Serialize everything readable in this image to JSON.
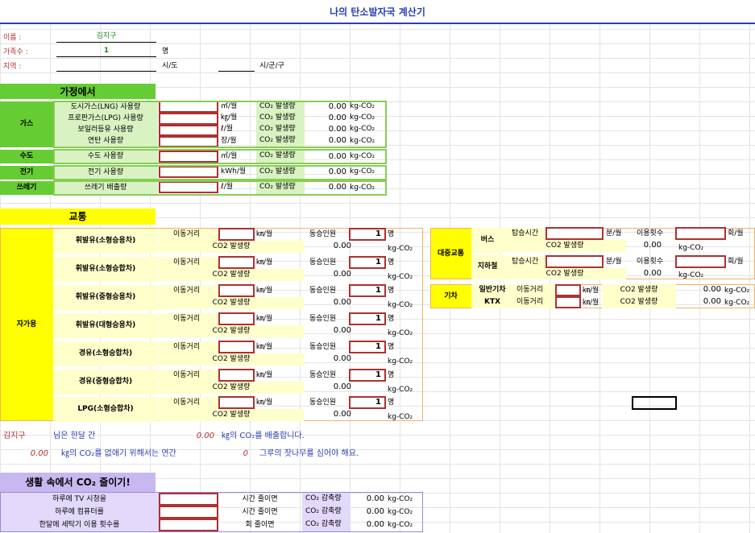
{
  "title": "나의 탄소발자국 계산기",
  "info": {
    "name_label": "이름 :",
    "name_value": "김지구",
    "family_label": "가족수 :",
    "family_value": "1",
    "family_unit": "명",
    "region_label": "지역 :",
    "region_sido": "시/도",
    "region_sigungu": "시/군/구"
  },
  "home": {
    "section_title": "가정에서",
    "categories": {
      "gas": "가스",
      "water": "수도",
      "electric": "전기",
      "trash": "쓰레기"
    },
    "rows": [
      {
        "label": "도시가스(LNG) 사용량",
        "unit": "㎥/월",
        "co2_label": "CO₂ 발생량",
        "value": "0.00",
        "value_unit": "kg-CO₂"
      },
      {
        "label": "프로판가스(LPG) 사용량",
        "unit": "㎏/월",
        "co2_label": "CO₂ 발생량",
        "value": "0.00",
        "value_unit": "kg-CO₂"
      },
      {
        "label": "보일러등유 사용량",
        "unit": "ℓ/월",
        "co2_label": "CO₂ 발생량",
        "value": "0.00",
        "value_unit": "kg-CO₂"
      },
      {
        "label": "연탄 사용량",
        "unit": "장/월",
        "co2_label": "CO₂ 발생량",
        "value": "0.00",
        "value_unit": "kg-CO₂"
      },
      {
        "label": "수도 사용량",
        "unit": "㎥/월",
        "co2_label": "CO₂ 발생량",
        "value": "0.00",
        "value_unit": "kg-CO₂"
      },
      {
        "label": "전기 사용량",
        "unit": "kWh/월",
        "co2_label": "CO₂ 발생량",
        "value": "0.00",
        "value_unit": "kg-CO₂"
      },
      {
        "label": "쓰레기 배출량",
        "unit": "ℓ/월",
        "co2_label": "CO₂ 발생량",
        "value": "0.00",
        "value_unit": "kg-CO₂"
      }
    ]
  },
  "transport": {
    "section_title": "교통",
    "car_category": "자가용",
    "distance_label": "이동거리",
    "distance_unit": "㎞/월",
    "passengers_label": "동승인원",
    "passengers_unit": "명",
    "co2_label": "CO2 발생량",
    "value_unit": "kg-CO₂",
    "cars": [
      {
        "label": "휘발유(소형승용차)",
        "passengers": "1",
        "value": "0.00"
      },
      {
        "label": "휘발유(소형승합차)",
        "passengers": "1",
        "value": "0.00"
      },
      {
        "label": "휘발유(중형승용차)",
        "passengers": "1",
        "value": "0.00"
      },
      {
        "label": "휘발유(대형승용차)",
        "passengers": "1",
        "value": "0.00"
      },
      {
        "label": "경유(소형승합차)",
        "passengers": "1",
        "value": "0.00"
      },
      {
        "label": "경유(중형승합차)",
        "passengers": "1",
        "value": "0.00"
      },
      {
        "label": "LPG(소형승합차)",
        "passengers": "1",
        "value": "0.00"
      }
    ],
    "public": {
      "category": "대중교통",
      "rows": [
        {
          "label": "버스",
          "time_label": "탑승시간",
          "time_unit": "분/월",
          "count_label": "이용횟수",
          "count_unit": "회/월",
          "co2_label": "CO2 발생량",
          "value": "0.00",
          "value_unit": "kg-CO₂"
        },
        {
          "label": "지하철",
          "time_label": "탑승시간",
          "time_unit": "분/월",
          "count_label": "이용횟수",
          "count_unit": "회/월",
          "co2_label": "CO2 발생량",
          "value": "0.00",
          "value_unit": "kg-CO₂"
        }
      ]
    },
    "train": {
      "category": "기차",
      "rows": [
        {
          "label": "일반기차",
          "distance_label": "이동거리",
          "distance_unit": "㎞/월",
          "co2_label": "CO2 발생량",
          "value": "0.00",
          "value_unit": "kg-CO₂"
        },
        {
          "label": "KTX",
          "distance_label": "이동거리",
          "distance_unit": "㎞/월",
          "co2_label": "CO2 발생량",
          "value": "0.00",
          "value_unit": "kg-CO₂"
        }
      ]
    }
  },
  "summary": {
    "name": "김지구",
    "line1_a": "님은 한달 간",
    "line1_value": "0.00",
    "line1_b": "㎏의 CO₂를 배출합니다.",
    "line2_value": "0.00",
    "line2_a": "㎏의 CO₂를 없애기 위해서는 연간",
    "line2_trees": "0",
    "line2_b": "그루의 잣나무를 심어야 해요."
  },
  "reduce": {
    "section_title": "생활 속에서 CO₂ 줄이기!",
    "rows": [
      {
        "label": "하루에 TV 시청을",
        "action": "시간 줄이면",
        "co2_label": "CO₂ 감축량",
        "value": "0.00",
        "value_unit": "kg-CO₂"
      },
      {
        "label": "하루에 컴퓨터를",
        "action": "시간 줄이면",
        "co2_label": "CO₂ 감축량",
        "value": "0.00",
        "value_unit": "kg-CO₂"
      },
      {
        "label": "한달에 세탁기 이용 횟수를",
        "action": "회 줄이면",
        "co2_label": "CO₂ 감축량",
        "value": "0.00",
        "value_unit": "kg-CO₂"
      }
    ]
  }
}
